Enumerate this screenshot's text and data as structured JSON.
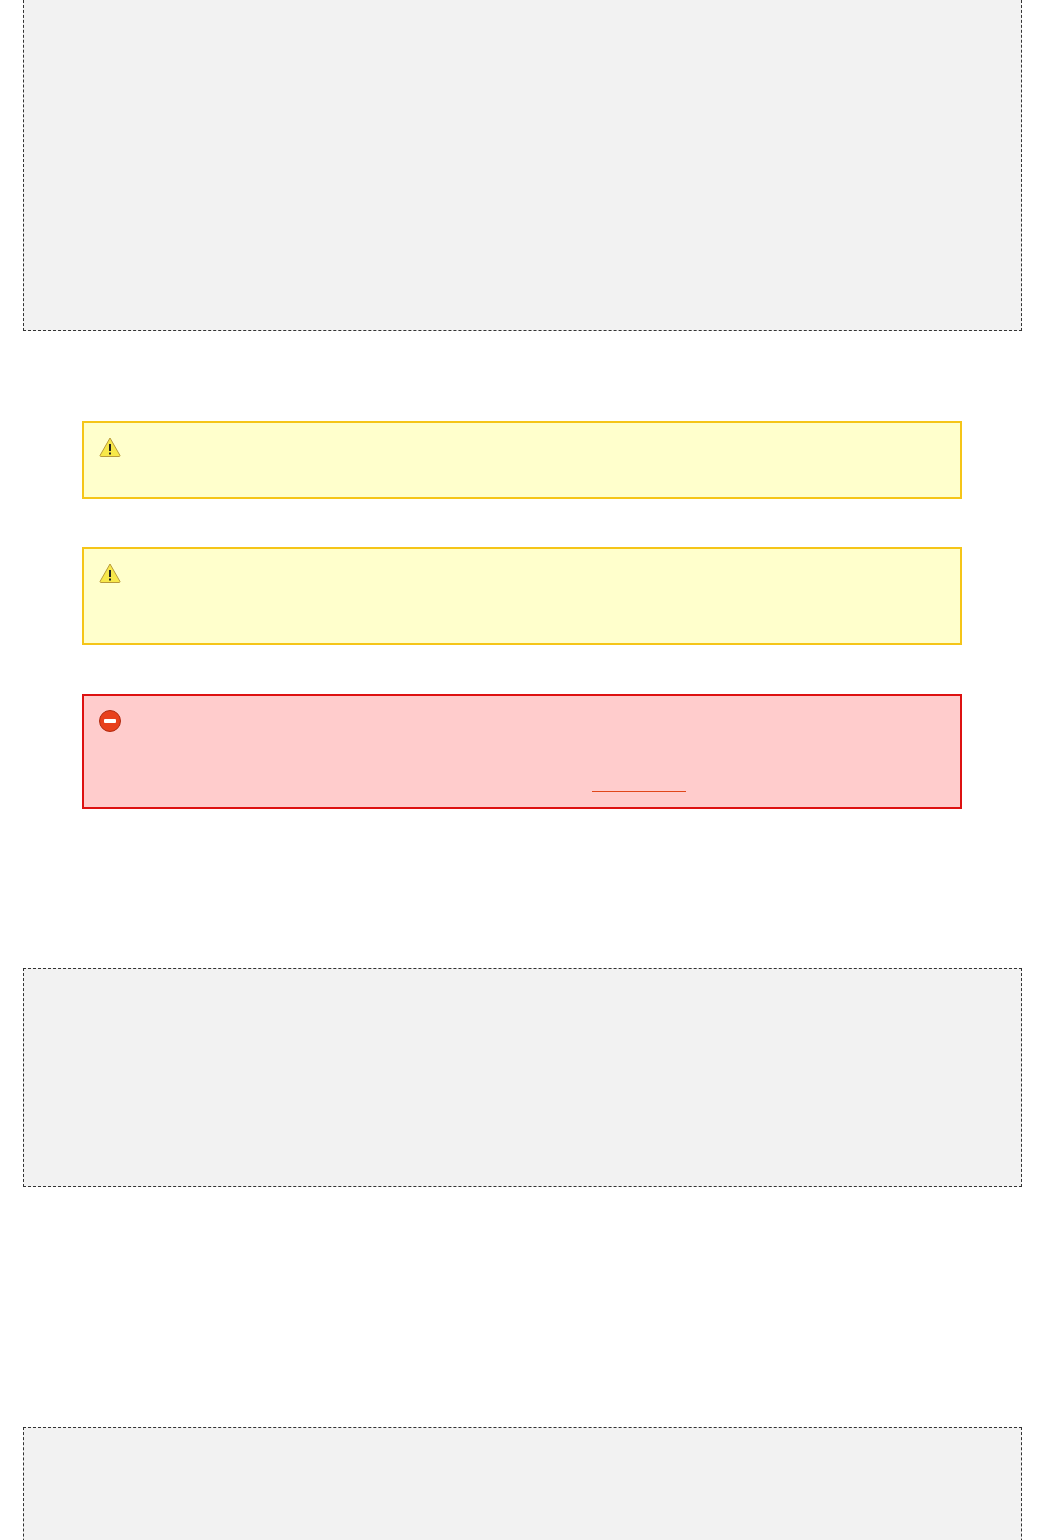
{
  "sections": [
    {
      "kind": "code"
    },
    {
      "kind": "warning"
    },
    {
      "kind": "warning"
    },
    {
      "kind": "error",
      "link": true
    },
    {
      "kind": "code"
    },
    {
      "kind": "code"
    }
  ]
}
